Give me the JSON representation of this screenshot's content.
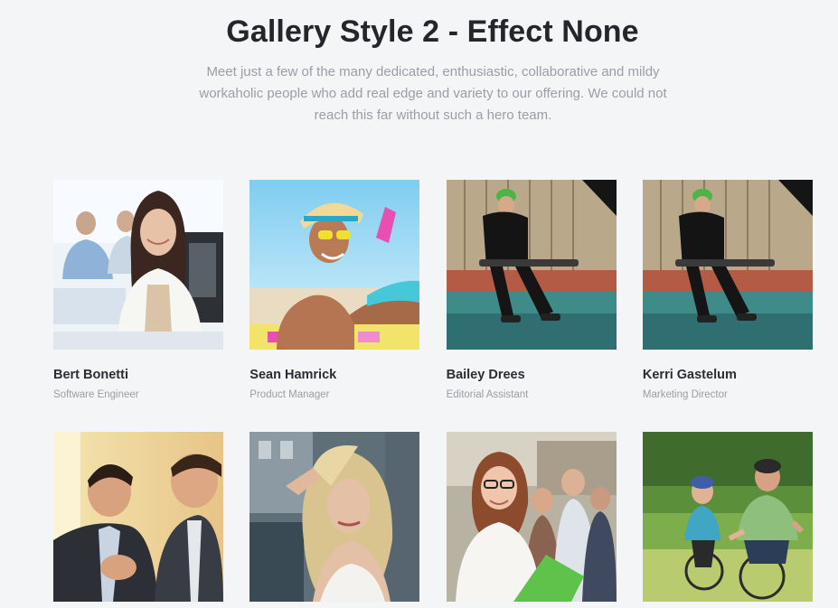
{
  "header": {
    "title": "Gallery Style 2 - Effect None",
    "subtitle": "Meet just a few of the many dedicated, enthusiastic, collaborative and mildy workaholic people who add real edge and variety to our offering. We could not reach this far without such a hero team."
  },
  "members": [
    {
      "name": "Bert Bonetti",
      "role": "Software Engineer",
      "photo": "woman-office-photo"
    },
    {
      "name": "Sean Hamrick",
      "role": "Product Manager",
      "photo": "woman-beach-photo"
    },
    {
      "name": "Bailey Drees",
      "role": "Editorial Assistant",
      "photo": "skateboarder-photo"
    },
    {
      "name": "Kerri Gastelum",
      "role": "Marketing Director",
      "photo": "skateboarder-photo"
    },
    {
      "name": "",
      "role": "",
      "photo": "businessmen-photo"
    },
    {
      "name": "",
      "role": "",
      "photo": "blonde-model-photo"
    },
    {
      "name": "",
      "role": "",
      "photo": "student-glasses-photo"
    },
    {
      "name": "",
      "role": "",
      "photo": "cyclists-photo"
    }
  ],
  "colors": {
    "background": "#f3f5f7",
    "title": "#24262b",
    "muted_text": "#9a9ea5"
  }
}
